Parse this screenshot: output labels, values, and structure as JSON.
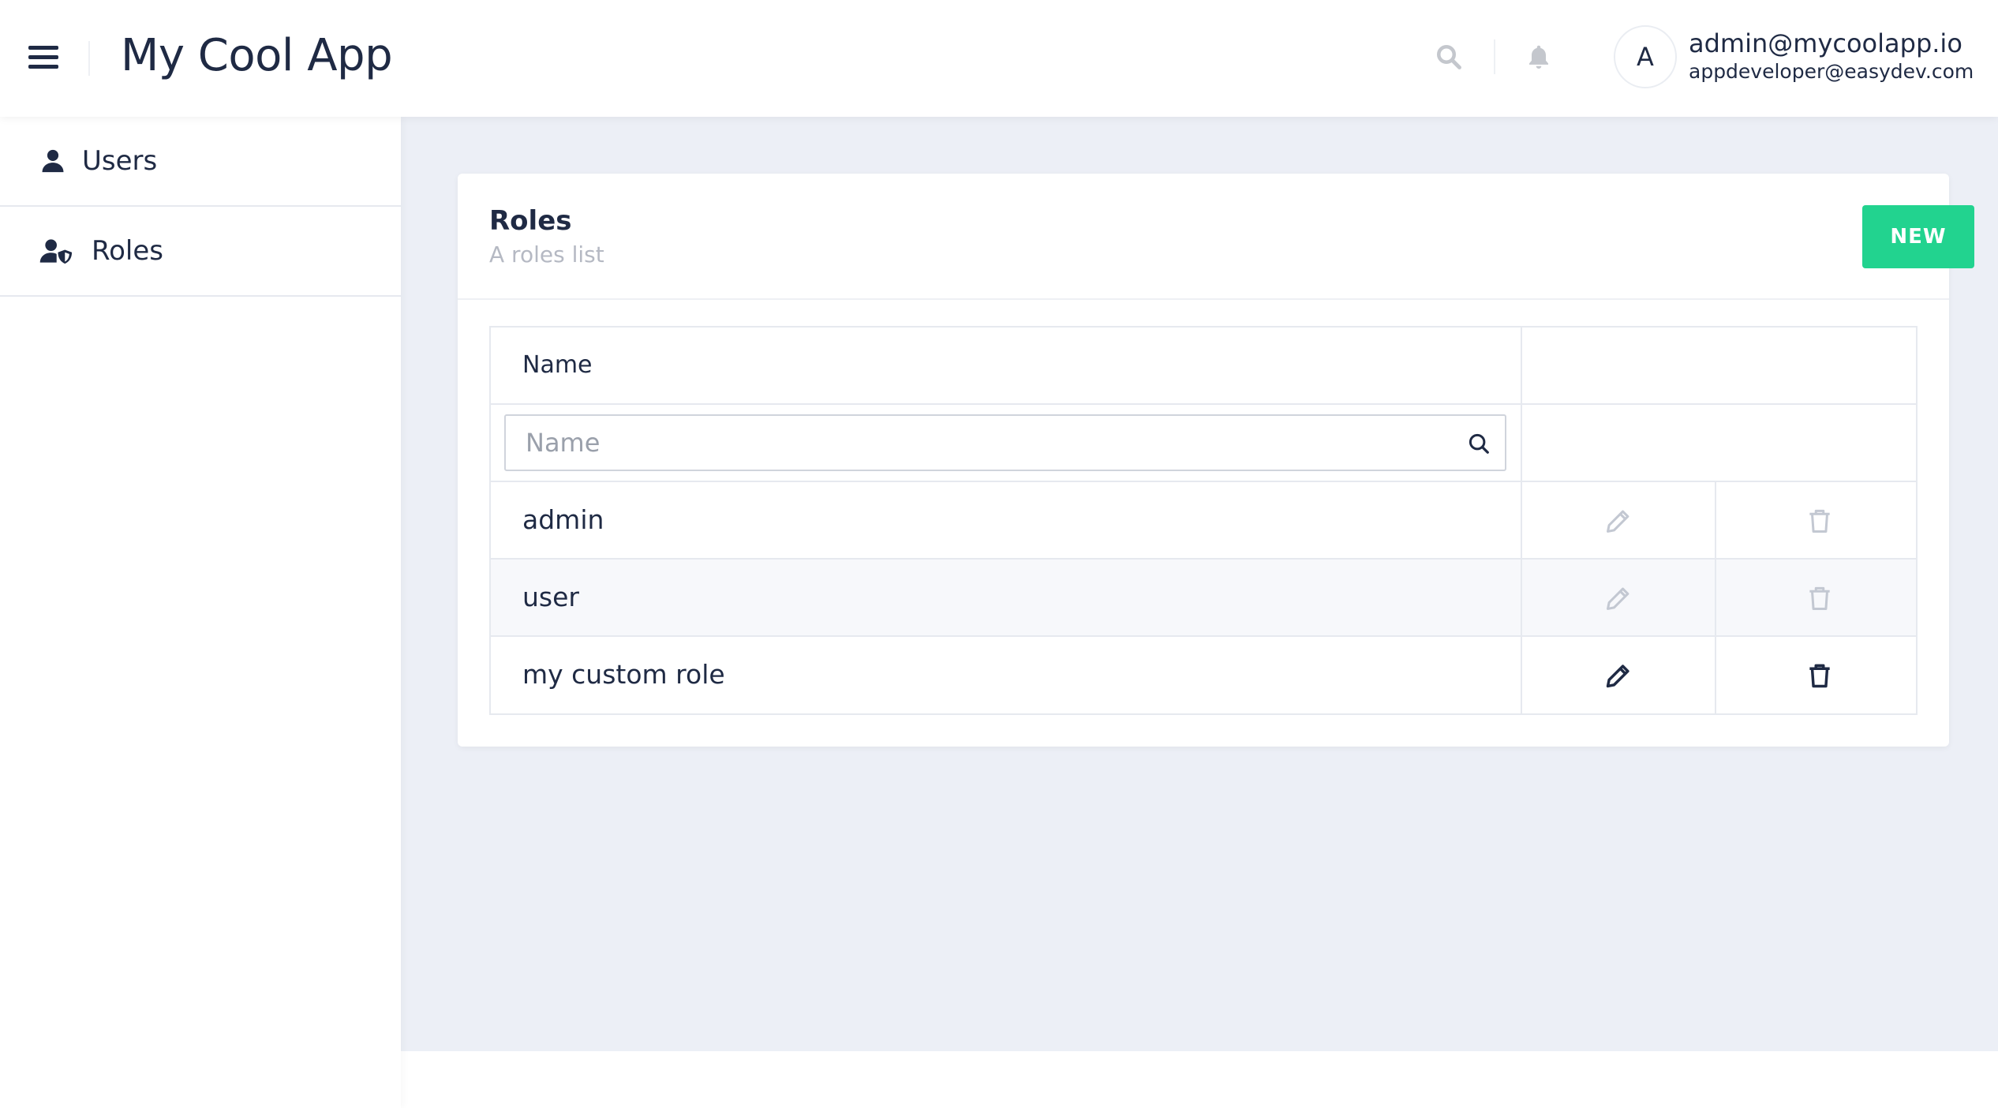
{
  "header": {
    "app_title": "My Cool App",
    "user_initial": "A",
    "user_email": "admin@mycoolapp.io",
    "user_sub": "appdeveloper@easydev.com"
  },
  "sidebar": {
    "items": [
      {
        "label": "Users",
        "icon": "user-icon"
      },
      {
        "label": "Roles",
        "icon": "user-shield-icon"
      }
    ]
  },
  "card": {
    "title": "Roles",
    "subtitle": "A roles list",
    "new_button": "NEW"
  },
  "table": {
    "column_header": "Name",
    "filter_placeholder": "Name",
    "rows": [
      {
        "name": "admin",
        "editable": false
      },
      {
        "name": "user",
        "editable": false
      },
      {
        "name": "my custom role",
        "editable": true
      }
    ]
  },
  "colors": {
    "accent": "#22d38f",
    "text": "#1f2a44",
    "background": "#eceff6",
    "disabled_icon": "#c3c8d2"
  }
}
